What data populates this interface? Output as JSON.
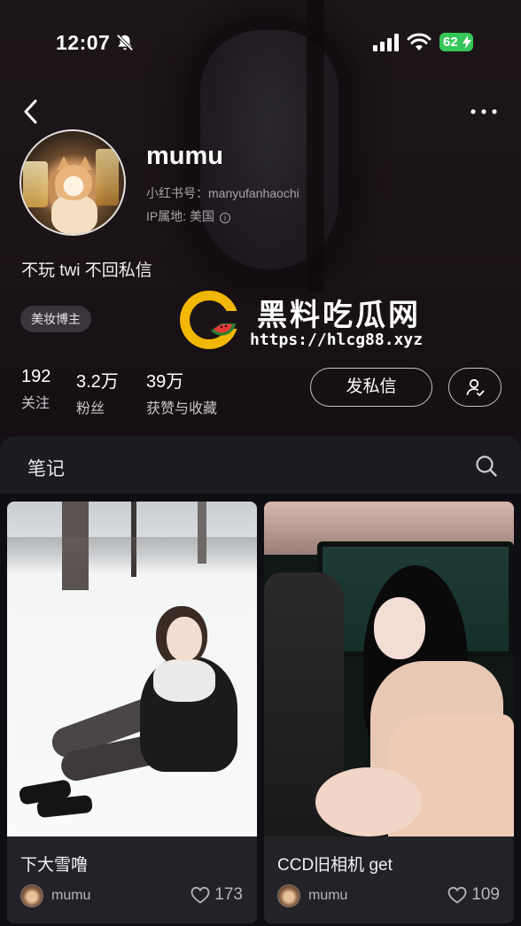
{
  "status_bar": {
    "time": "12:07",
    "battery": "62",
    "icons": [
      "bell-slash-icon",
      "signal-icon",
      "wifi-icon",
      "battery-charging-icon"
    ]
  },
  "nav": {
    "back_icon": "chevron-left-icon",
    "more_icon": "ellipsis-icon"
  },
  "profile": {
    "username": "mumu",
    "red_id": "小红书号：manyufanhaochi",
    "ip_location": "IP属地: 美国",
    "bio": "不玩 twi 不回私信",
    "tag": "美妆博主",
    "stats": [
      {
        "value": "192",
        "label": "关注"
      },
      {
        "value": "3.2万",
        "label": "粉丝"
      },
      {
        "value": "39万",
        "label": "获赞与收藏"
      }
    ],
    "message_button": "发私信"
  },
  "watermark": {
    "title": "黑料吃瓜网",
    "url": "https://hlcg88.xyz",
    "logo_colors": [
      "#f2b705",
      "#e53935",
      "#2e7d32"
    ]
  },
  "notes": {
    "tab_label": "笔记",
    "cards": [
      {
        "title": "下大雪噜",
        "author": "mumu",
        "likes": "173"
      },
      {
        "title": "CCD旧相机 get",
        "author": "mumu",
        "likes": "109"
      }
    ]
  },
  "colors": {
    "background": "#141217",
    "panel": "#1c1b20",
    "card": "#232227",
    "battery": "#35c759"
  }
}
